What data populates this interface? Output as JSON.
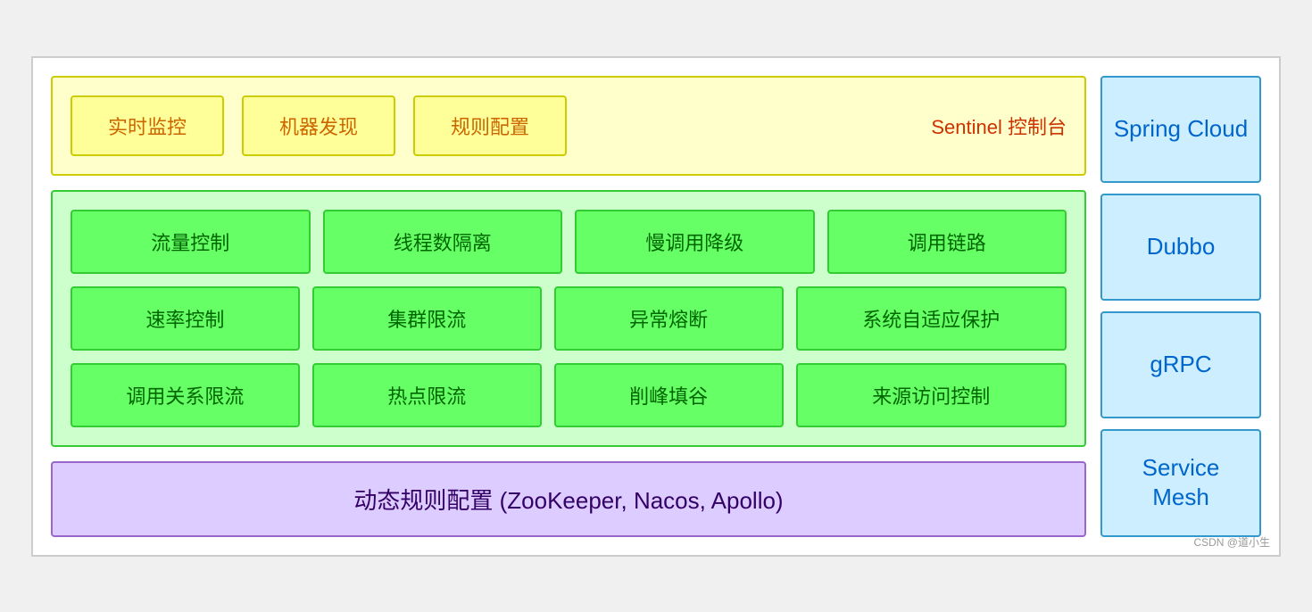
{
  "sentinel": {
    "boxes": [
      "实时监控",
      "机器发现",
      "规则配置"
    ],
    "label": "Sentinel 控制台"
  },
  "features": {
    "row1": [
      "流量控制",
      "线程数隔离",
      "慢调用降级",
      "调用链路"
    ],
    "row2": [
      "速率控制",
      "集群限流",
      "异常熔断",
      "系统自适应保护"
    ],
    "row3": [
      "调用关系限流",
      "热点限流",
      "削峰填谷",
      "来源访问控制"
    ]
  },
  "dynamic": {
    "label": "动态规则配置 (ZooKeeper, Nacos, Apollo)"
  },
  "sidebar": {
    "items": [
      "Spring\nCloud",
      "Dubbo",
      "gRPC",
      "Service\nMesh"
    ]
  },
  "watermark": "CSDN @道小生"
}
